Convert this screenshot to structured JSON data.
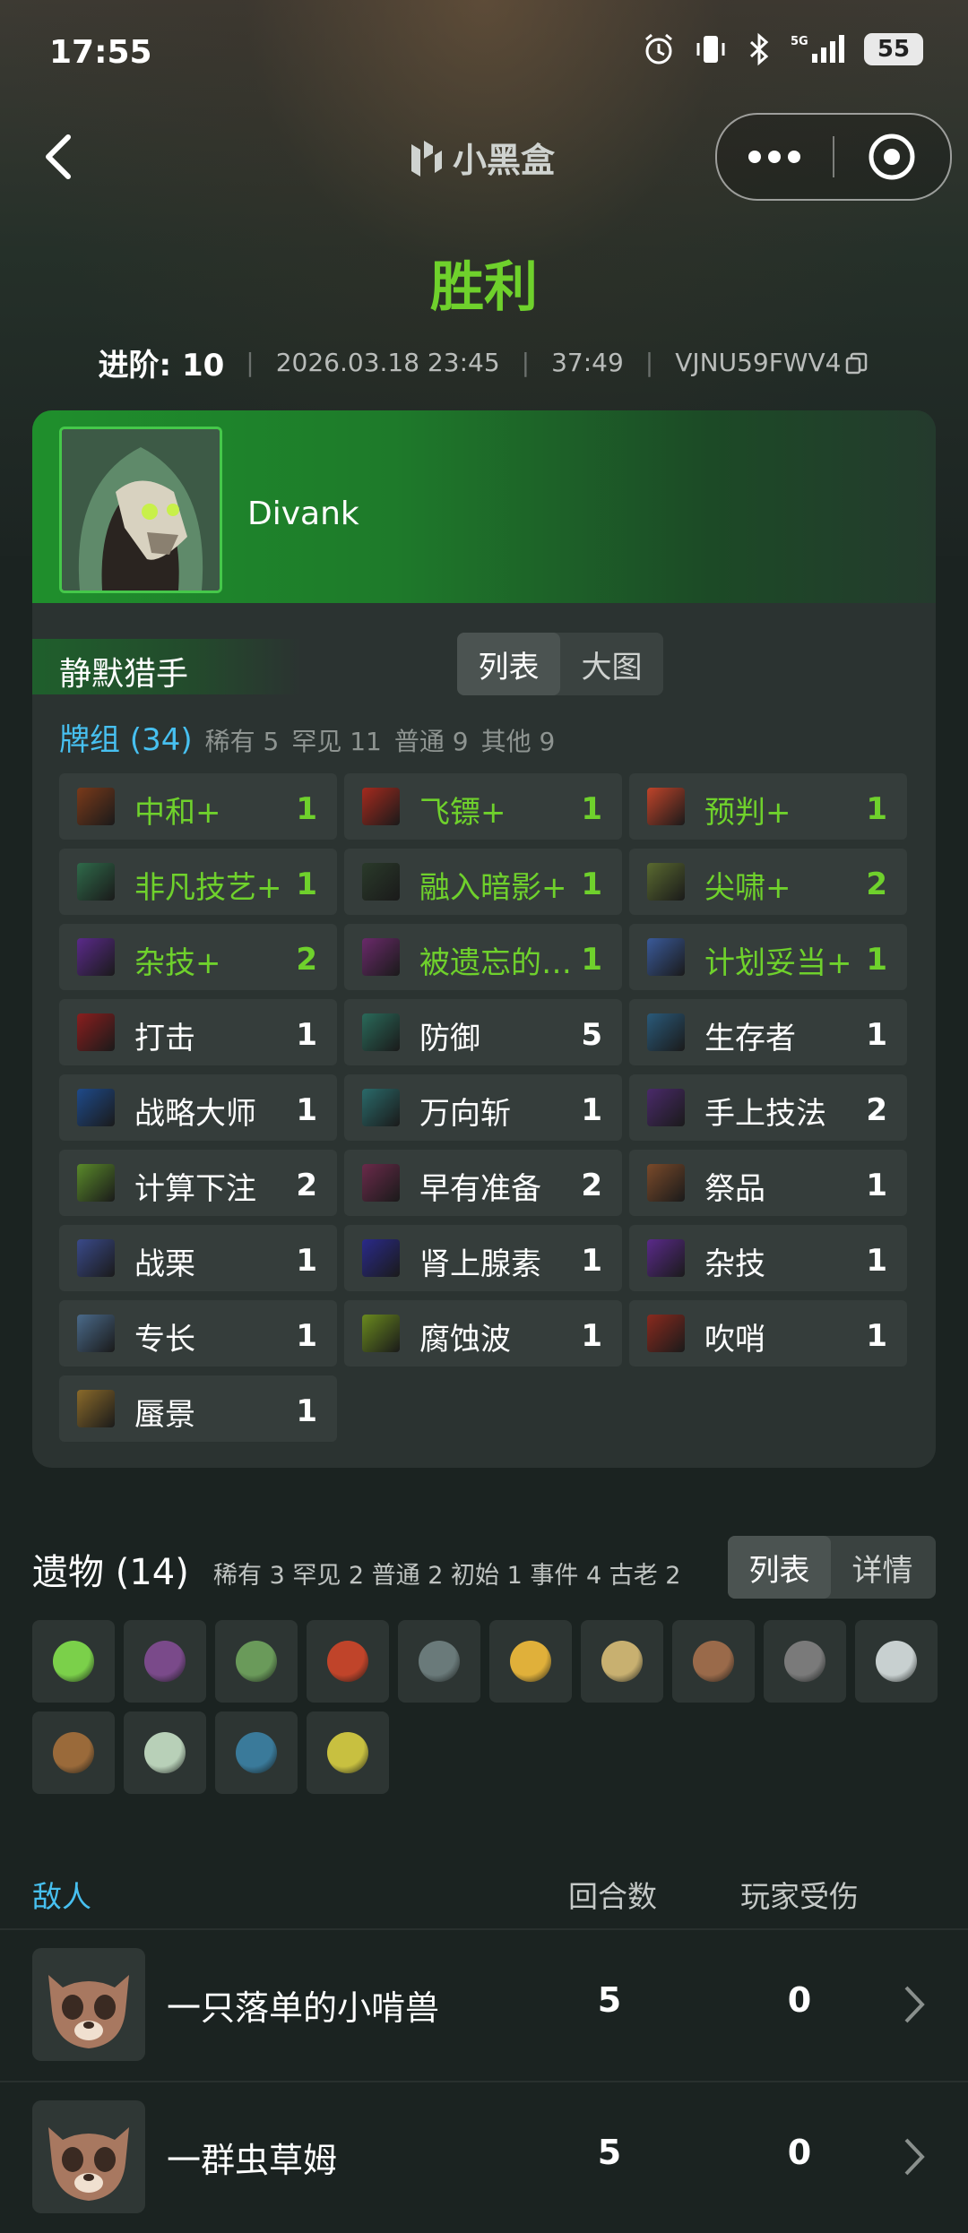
{
  "status_bar": {
    "time": "17:55",
    "battery": "55"
  },
  "header": {
    "brand": "小黑盒"
  },
  "result": {
    "title": "胜利",
    "ascension_label": "进阶: 10",
    "datetime": "2026.03.18 23:45",
    "duration": "37:49",
    "seed": "VJNU59FWV4"
  },
  "player": {
    "name": "Divank",
    "character": "静默猎手"
  },
  "view_toggle": {
    "list": "列表",
    "big": "大图"
  },
  "deck": {
    "title": "牌组 (34)",
    "stats": [
      "稀有 5",
      "罕见 11",
      "普通 9",
      "其他 9"
    ],
    "cards": [
      {
        "name": "中和+",
        "count": "1",
        "upgraded": true,
        "icon_color": "#7a3a1a"
      },
      {
        "name": "飞镖+",
        "count": "1",
        "upgraded": true,
        "icon_color": "#a52a1e"
      },
      {
        "name": "预判+",
        "count": "1",
        "upgraded": true,
        "icon_color": "#c0442a"
      },
      {
        "name": "非凡技艺+",
        "count": "1",
        "upgraded": true,
        "icon_color": "#2f6a4a"
      },
      {
        "name": "融入暗影+",
        "count": "1",
        "upgraded": true,
        "icon_color": "#2a3a2a"
      },
      {
        "name": "尖啸+",
        "count": "2",
        "upgraded": true,
        "icon_color": "#5a6a30"
      },
      {
        "name": "杂技+",
        "count": "2",
        "upgraded": true,
        "icon_color": "#5a2a8a"
      },
      {
        "name": "被遗忘的…",
        "count": "1",
        "upgraded": true,
        "icon_color": "#6a2a6a"
      },
      {
        "name": "计划妥当+",
        "count": "1",
        "upgraded": true,
        "icon_color": "#3a5a9a"
      },
      {
        "name": "打击",
        "count": "1",
        "upgraded": false,
        "icon_color": "#8a1e1e"
      },
      {
        "name": "防御",
        "count": "5",
        "upgraded": false,
        "icon_color": "#2a6a5a"
      },
      {
        "name": "生存者",
        "count": "1",
        "upgraded": false,
        "icon_color": "#2a5a7a"
      },
      {
        "name": "战略大师",
        "count": "1",
        "upgraded": false,
        "icon_color": "#1e4a8a"
      },
      {
        "name": "万向斩",
        "count": "1",
        "upgraded": false,
        "icon_color": "#2a6a6a"
      },
      {
        "name": "手上技法",
        "count": "2",
        "upgraded": false,
        "icon_color": "#4a2a6a"
      },
      {
        "name": "计算下注",
        "count": "2",
        "upgraded": false,
        "icon_color": "#5a8a2a"
      },
      {
        "name": "早有准备",
        "count": "2",
        "upgraded": false,
        "icon_color": "#6a2a4a"
      },
      {
        "name": "祭品",
        "count": "1",
        "upgraded": false,
        "icon_color": "#7a4a2a"
      },
      {
        "name": "战栗",
        "count": "1",
        "upgraded": false,
        "icon_color": "#3a4a8a"
      },
      {
        "name": "肾上腺素",
        "count": "1",
        "upgraded": false,
        "icon_color": "#2a2a8a"
      },
      {
        "name": "杂技",
        "count": "1",
        "upgraded": false,
        "icon_color": "#5a2a8a"
      },
      {
        "name": "专长",
        "count": "1",
        "upgraded": false,
        "icon_color": "#4a6a8a"
      },
      {
        "name": "腐蚀波",
        "count": "1",
        "upgraded": false,
        "icon_color": "#6a8a1e"
      },
      {
        "name": "吹哨",
        "count": "1",
        "upgraded": false,
        "icon_color": "#8a2a1e"
      },
      {
        "name": "蜃景",
        "count": "1",
        "upgraded": false,
        "icon_color": "#8a6a2a"
      }
    ]
  },
  "relics": {
    "title": "遗物 (14)",
    "stats": "稀有 3 罕见 2 普通 2 初始 1 事件 4 古老 2",
    "toggle": {
      "list": "列表",
      "detail": "详情"
    },
    "items": [
      {
        "icon": "ring-snake-icon",
        "color": "#7bd04a"
      },
      {
        "icon": "orb-icon",
        "color": "#7a4a8a"
      },
      {
        "icon": "serpent-icon",
        "color": "#6a9a5a"
      },
      {
        "icon": "lantern-icon",
        "color": "#c0442a"
      },
      {
        "icon": "ring-icon",
        "color": "#6a7a7a"
      },
      {
        "icon": "feather-icon",
        "color": "#e0b03a"
      },
      {
        "icon": "cradle-icon",
        "color": "#c8b070"
      },
      {
        "icon": "flask-icon",
        "color": "#9a6a4a"
      },
      {
        "icon": "stone-icon",
        "color": "#7a7a7a"
      },
      {
        "icon": "pebble-icon",
        "color": "#c8d0d0"
      },
      {
        "icon": "crate-icon",
        "color": "#9a6a3a"
      },
      {
        "icon": "teapot-icon",
        "color": "#b8d0b8"
      },
      {
        "icon": "anchor-icon",
        "color": "#3a7a9a"
      },
      {
        "icon": "mango-icon",
        "color": "#c8c040"
      }
    ]
  },
  "enemies": {
    "header": {
      "label": "敌人",
      "rounds": "回合数",
      "damage": "玩家受伤"
    },
    "rows": [
      {
        "name": "一只落单的小啃兽",
        "rounds": "5",
        "damage": "0"
      },
      {
        "name": "一群虫草姆",
        "rounds": "5",
        "damage": "0"
      }
    ]
  }
}
